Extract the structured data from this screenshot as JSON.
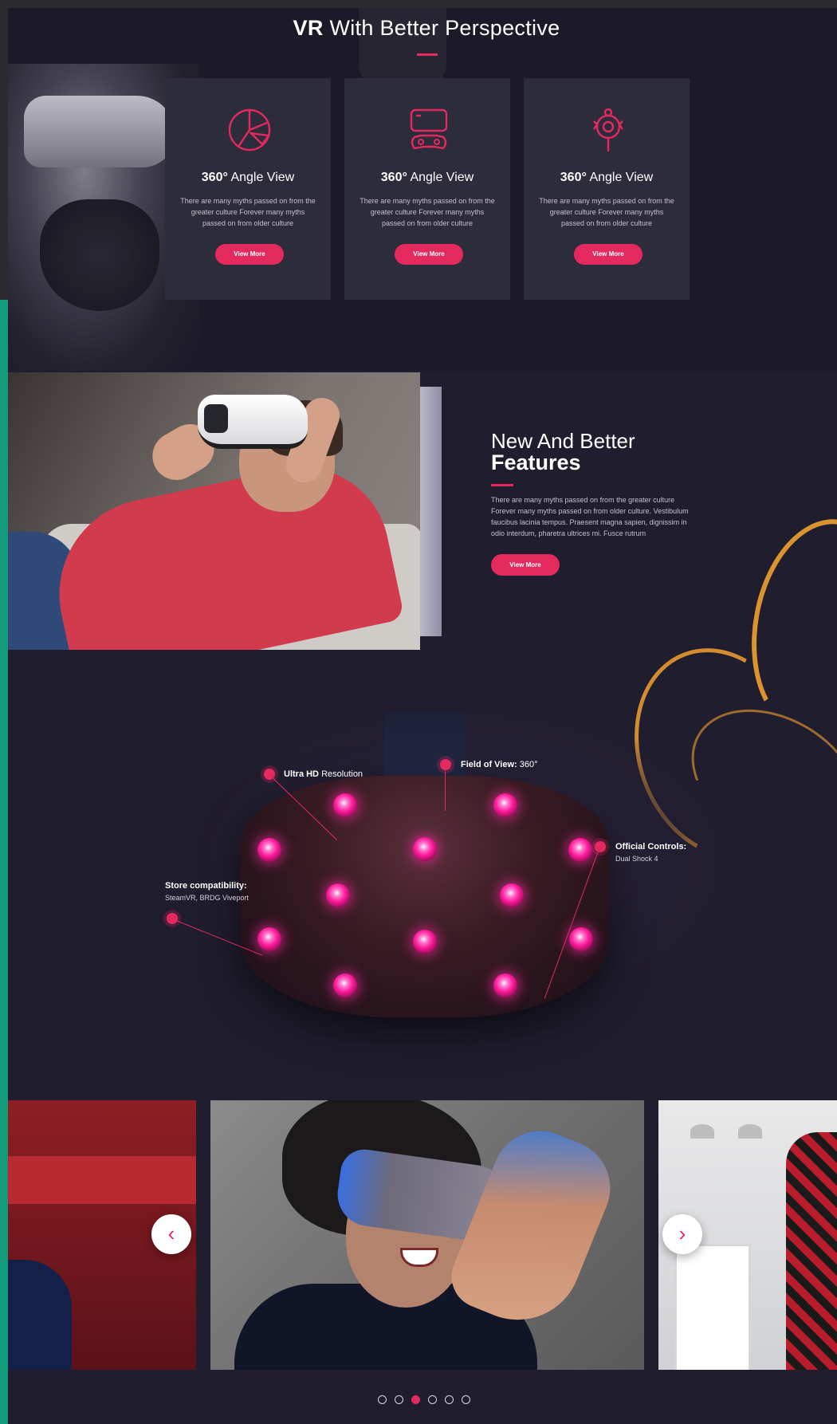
{
  "header": {
    "title_bold": "VR",
    "title_rest": " With Better Perspective"
  },
  "cards": [
    {
      "icon": "pie-chart-icon",
      "title_bold": "360°",
      "title_rest": " Angle View",
      "text": "There are many myths passed on from the greater culture Forever many myths passed on from older culture",
      "button": "View More"
    },
    {
      "icon": "gamepad-icon",
      "title_bold": "360°",
      "title_rest": " Angle View",
      "text": "There are many myths passed on from the greater culture Forever many myths passed on from older culture",
      "button": "View More"
    },
    {
      "icon": "webcam-icon",
      "title_bold": "360°",
      "title_rest": " Angle View",
      "text": "There are many myths passed on from the greater culture Forever many myths passed on from older culture",
      "button": "View More"
    }
  ],
  "features": {
    "title_light": "New And Better",
    "title_bold": "Features",
    "text": "There are many myths passed on from the greater culture Forever many myths passed on from older culture. Vestibulum faucibus lacinia tempus. Praesent magna sapien, dignissim in odio interdum, pharetra ultrices mi. Fusce rutrum",
    "button": "View More"
  },
  "hotspots": {
    "ultra_hd": {
      "bold": "Ultra HD",
      "rest": " Resolution"
    },
    "fov": {
      "bold": "Field of View:",
      "rest": " 360°"
    },
    "controls": {
      "bold": "Official Controls:",
      "sub": "Dual Shock 4"
    },
    "store": {
      "bold": "Store compatibility:",
      "sub": "SteamVR, BRDG Viveport"
    }
  },
  "carousel": {
    "prev_icon": "chevron-left-icon",
    "next_icon": "chevron-right-icon",
    "prev_symbol": "‹",
    "next_symbol": "›",
    "dot_count": 6,
    "active_dot_index": 2
  },
  "colors": {
    "accent": "#e4295f",
    "background": "#201d2e",
    "card": "#2d2c3b"
  }
}
